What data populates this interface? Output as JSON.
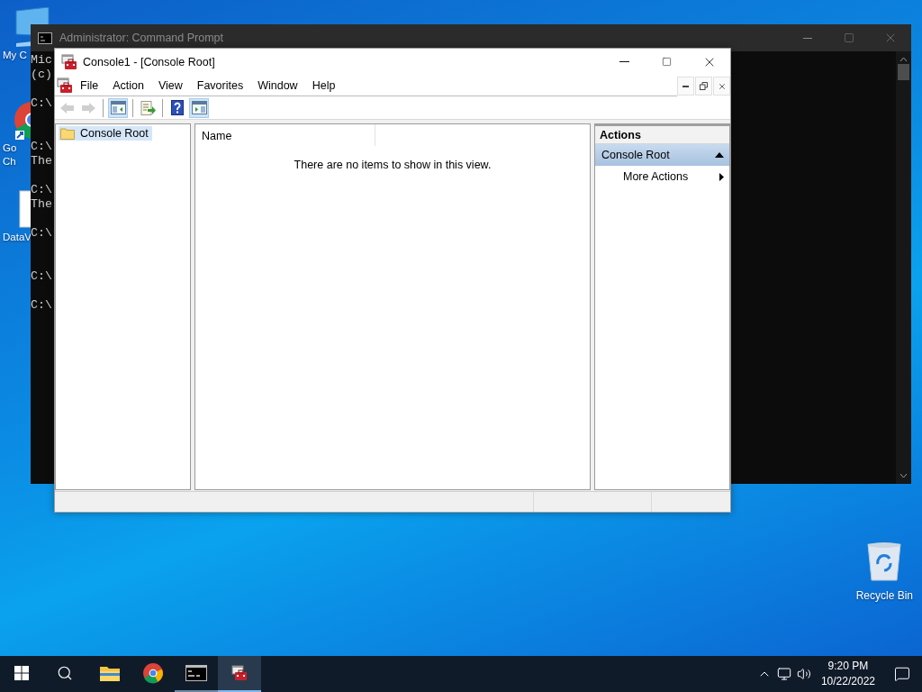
{
  "desktop": {
    "icons": [
      {
        "kind": "computer",
        "label_lines": [
          "My C"
        ]
      },
      {
        "kind": "browser",
        "label_lines": [
          "Go",
          "Ch"
        ]
      },
      {
        "kind": "document",
        "label_lines": [
          "DataV"
        ]
      }
    ],
    "corner_icons": [
      {
        "kind": "recycle-bin",
        "label_lines": [
          "Recycle Bin"
        ]
      }
    ]
  },
  "console_window": {
    "title": "Administrator: Command Prompt",
    "active": false,
    "lines": [
      {
        "kind": "text",
        "text": "Mic"
      },
      {
        "kind": "text",
        "text": "(c)"
      },
      {
        "kind": "blank"
      },
      {
        "kind": "text",
        "text": "C:\\"
      },
      {
        "kind": "blank"
      },
      {
        "kind": "blank"
      },
      {
        "kind": "text",
        "text": "C:\\"
      },
      {
        "kind": "text",
        "text": "The"
      },
      {
        "kind": "blank"
      },
      {
        "kind": "text",
        "text": "C:\\"
      },
      {
        "kind": "text",
        "text": "The"
      },
      {
        "kind": "blank"
      },
      {
        "kind": "text",
        "text": "C:\\"
      },
      {
        "kind": "blank"
      },
      {
        "kind": "blank"
      },
      {
        "kind": "text",
        "text": "C:\\"
      },
      {
        "kind": "blank"
      },
      {
        "kind": "text",
        "text": "C:\\"
      }
    ]
  },
  "mmc_window": {
    "title": "Console1 - [Console Root]",
    "active": true,
    "menu": [
      "File",
      "Action",
      "View",
      "Favorites",
      "Window",
      "Help"
    ],
    "toolbar": [
      {
        "kind": "back",
        "disabled": true,
        "on": false
      },
      {
        "kind": "forward",
        "disabled": true,
        "on": false
      },
      {
        "kind": "separator"
      },
      {
        "kind": "show-tree",
        "disabled": false,
        "on": true
      },
      {
        "kind": "separator"
      },
      {
        "kind": "export",
        "disabled": false,
        "on": false
      },
      {
        "kind": "separator"
      },
      {
        "kind": "help",
        "disabled": false,
        "on": false
      },
      {
        "kind": "show-actions",
        "disabled": false,
        "on": true
      }
    ],
    "tree": {
      "items": [
        {
          "label": "Console Root",
          "selected": true
        }
      ]
    },
    "results": {
      "columns": [
        "Name"
      ],
      "empty_message": "There are no items to show in this view."
    },
    "actions": {
      "title": "Actions",
      "sections": [
        {
          "label": "Console Root",
          "expanded": true,
          "items": [
            {
              "label": "More Actions",
              "kind": "submenu"
            }
          ]
        }
      ]
    }
  },
  "taskbar": {
    "apps": [
      {
        "kind": "explorer",
        "running": false,
        "selected": false
      },
      {
        "kind": "browser",
        "running": false,
        "selected": false
      },
      {
        "kind": "terminal",
        "running": true,
        "selected": false
      },
      {
        "kind": "console",
        "running": true,
        "selected": true
      }
    ],
    "clock": {
      "time": "9:20 PM",
      "date": "10/22/2022"
    }
  }
}
